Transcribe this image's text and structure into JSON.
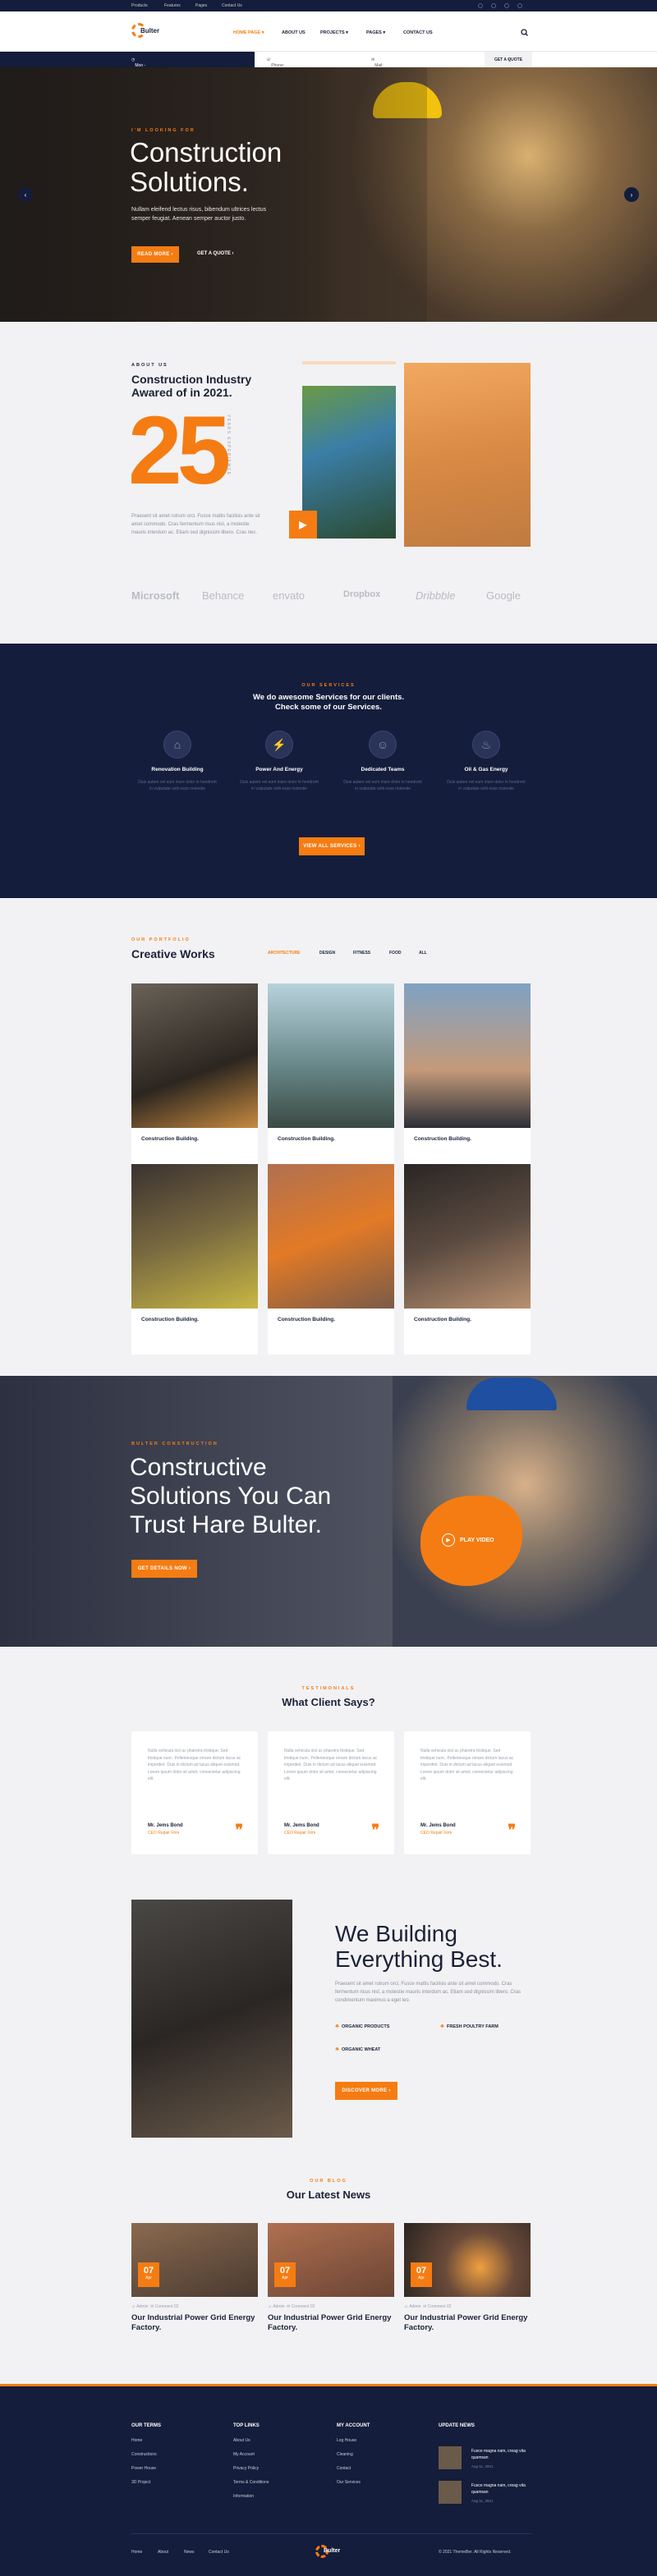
{
  "topbar": {
    "links": [
      "Products",
      "Features",
      "Pages",
      "Contact Us"
    ]
  },
  "header": {
    "logo": "Bulter",
    "menu": [
      "HOME PAGE",
      "ABOUT US",
      "PROJECTS",
      "PAGES",
      "CONTACT US"
    ],
    "hours": "Mon - Sat 8.00 - 17.30, Sunday - CLOSED",
    "phone": "Phone: +01 123 456 789",
    "email": "Mail: example@email.com",
    "quote_btn": "GET A QUOTE"
  },
  "hero": {
    "kicker": "I'M LOOKING FOR",
    "title_line1": "Construction",
    "title_line2": "Solutions.",
    "text_line1": "Nullam eleifend lectus risus, bibendum ultrices lectus",
    "text_line2": "semper feugiat. Aenean semper auctor justo.",
    "btn_primary": "READ MORE",
    "btn_secondary": "GET A QUOTE"
  },
  "about": {
    "kicker": "ABOUT US",
    "title_line1": "Construction Industry",
    "title_line2": "Awared of in 2021.",
    "number": "25",
    "vertical_label": "YEARS EXPERIENCE",
    "text": "Praesent sit amet rutrum orci. Fusce mattis facilisis ante sit amet commodo. Cras fermentum risus nisl, a molestie mauris interdum ac. Etiam sed dignissim libero. Cras nec.",
    "brands": [
      "Microsoft",
      "Behance",
      "envato",
      "Dropbox",
      "Dribbble",
      "Google"
    ]
  },
  "services": {
    "kicker": "OUR SERVICES",
    "title_line1": "We do awesome Services for our clients.",
    "title_line2": "Check some of our Services.",
    "items": [
      {
        "title": "Renovation Building",
        "text": "Duis autem vel eum iriure dolor in hendrerit in vulputate velit esse molestie"
      },
      {
        "title": "Power And Energy",
        "text": "Duis autem vel eum iriure dolor in hendrerit in vulputate velit esse molestie"
      },
      {
        "title": "Dedicated Teams",
        "text": "Duis autem vel eum iriure dolor in hendrerit in vulputate velit esse molestie"
      },
      {
        "title": "Oil & Gas Energy",
        "text": "Duis autem vel eum iriure dolor in hendrerit in vulputate velit esse molestie"
      }
    ],
    "btn": "VIEW ALL SERVICES"
  },
  "portfolio": {
    "kicker": "OUR PORTFOLIO",
    "title": "Creative Works",
    "filters": [
      "ARCHITECTURE",
      "DESIGN",
      "FITNESS",
      "FOOD",
      "ALL"
    ],
    "items": [
      "Construction Building.",
      "Construction Building.",
      "Construction Building.",
      "Construction Building.",
      "Construction Building.",
      "Construction Building."
    ]
  },
  "cta": {
    "kicker": "BULTER CONSTRUCTION",
    "line1": "Constructive",
    "line2": "Solutions You Can",
    "line3": "Trust Hare Bulter.",
    "btn": "GET DETAILS NOW",
    "play": "PLAY VIDEO"
  },
  "testimonials": {
    "kicker": "TESTIMONIALS",
    "title": "What Client Says?",
    "items": [
      {
        "quote": "Nulla vehicula nisl ac pharetra tristique. Sed tristique nunc. Pellentesque ornare dictum lacus ac imperdiet. Duis in dictum ad lacus aliquet euismod. Lorem ipsum dolor sit amet, consectetur adipiscing elit.",
        "name": "Mr. Jems Bond",
        "role": "CEO Repair Firm"
      },
      {
        "quote": "Nulla vehicula nisl ac pharetra tristique. Sed tristique nunc. Pellentesque ornare dictum lacus ac imperdiet. Duis in dictum ad lacus aliquet euismod. Lorem ipsum dolor sit amet, consectetur adipiscing elit.",
        "name": "Mr. Jems Bond",
        "role": "CEO Repair Firm"
      },
      {
        "quote": "Nulla vehicula nisl ac pharetra tristique. Sed tristique nunc. Pellentesque ornare dictum lacus ac imperdiet. Duis in dictum ad lacus aliquet euismod. Lorem ipsum dolor sit amet, consectetur adipiscing elit.",
        "name": "Mr. Jems Bond",
        "role": "CEO Repair Firm"
      }
    ]
  },
  "building": {
    "title_line1": "We Building",
    "title_line2": "Everything Best.",
    "text": "Praesent sit amet rutrum orci. Fusce mattis facilisis ante sit amet commodo. Cras fermentum risus nisl, a molestie mauris interdum ac. Etiam sed dignissim libero. Cras condimentum maximus a eget leo.",
    "features": [
      "ORGANIC PRODUCTS",
      "FRESH POULTRY FARM",
      "ORGANIC WHEAT"
    ],
    "btn": "DISCOVER MORE"
  },
  "blog": {
    "kicker": "OUR BLOG",
    "title": "Our Latest News",
    "items": [
      {
        "day": "07",
        "month": "Apr",
        "author": "Admin",
        "comments": "Comment 02",
        "title": "Our Industrial Power Grid Energy Factory."
      },
      {
        "day": "07",
        "month": "Apr",
        "author": "Admin",
        "comments": "Comment 02",
        "title": "Our Industrial Power Grid Energy Factory."
      },
      {
        "day": "07",
        "month": "Apr",
        "author": "Admin",
        "comments": "Comment 02",
        "title": "Our Industrial Power Grid Energy Factory."
      }
    ]
  },
  "footer": {
    "cols": [
      {
        "title": "OUR TERMS",
        "items": [
          "Home",
          "Constructions",
          "Power House",
          "3D Project"
        ]
      },
      {
        "title": "TOP LINKS",
        "items": [
          "About Us",
          "My Account",
          "Privacy Policy",
          "Terms & Conditions",
          "Information"
        ]
      },
      {
        "title": "MY ACCOUNT",
        "items": [
          "Log House",
          "Cleaning",
          "Contact",
          "Our Services"
        ]
      }
    ],
    "updates_title": "UPDATE NEWS",
    "updates": [
      {
        "title": "Fusce magna nam, creag vita quamsan",
        "date": "Aug 11, 2021"
      },
      {
        "title": "Fusce magna nam, creag vita quamsan",
        "date": "Aug 11, 2021"
      }
    ],
    "bottom_links": [
      "Home",
      "About",
      "News",
      "Contact Us"
    ],
    "copyright": "© 2021 ThemeBer. All Rights Reserved."
  },
  "colors": {
    "accent": "#f57c12",
    "navy": "#141d3b"
  }
}
